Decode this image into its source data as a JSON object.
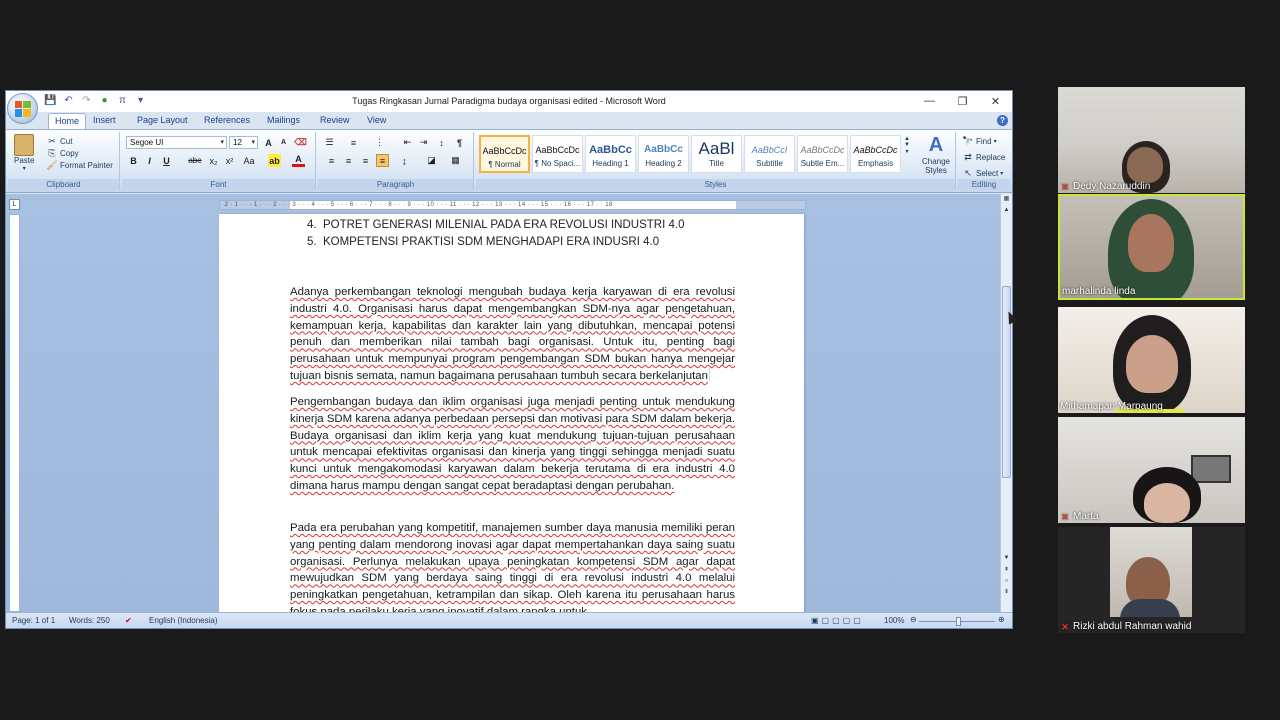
{
  "window": {
    "title": "Tugas Ringkasan Jurnal Paradigma budaya organisasi edited - Microsoft Word",
    "minimize": "—",
    "restore": "❐",
    "close": "✕"
  },
  "ribbon_tabs": [
    "Home",
    "Insert",
    "Page Layout",
    "References",
    "Mailings",
    "Review",
    "View"
  ],
  "clipboard": {
    "paste": "Paste",
    "cut": "Cut",
    "copy": "Copy",
    "format_painter": "Format Painter",
    "label": "Clipboard"
  },
  "font": {
    "family": "Segoe UI",
    "size": "12",
    "label": "Font",
    "bold": "B",
    "italic": "I",
    "underline": "U",
    "strike": "abe",
    "subscript": "x₂",
    "superscript": "x²",
    "change_case": "Aa",
    "grow": "A",
    "shrink": "A"
  },
  "paragraph": {
    "label": "Paragraph"
  },
  "styles": {
    "label": "Styles",
    "items": [
      {
        "preview": "AaBbCcDc",
        "name": "¶ Normal"
      },
      {
        "preview": "AaBbCcDc",
        "name": "¶ No Spaci..."
      },
      {
        "preview": "AaBbCc",
        "name": "Heading 1"
      },
      {
        "preview": "AaBbCc",
        "name": "Heading 2"
      },
      {
        "preview": "AaBl",
        "name": "Title"
      },
      {
        "preview": "AaBbCcI",
        "name": "Subtitle"
      },
      {
        "preview": "AaBbCcDc",
        "name": "Subtle Em..."
      },
      {
        "preview": "AaBbCcDc",
        "name": "Emphasis"
      }
    ],
    "change_styles": "Change Styles"
  },
  "editing": {
    "label": "Editing",
    "find": "Find",
    "replace": "Replace",
    "select": "Select"
  },
  "document": {
    "list": [
      "4.  POTRET GENERASI MILENIAL PADA ERA REVOLUSI INDUSTRI 4.0",
      "5.  KOMPETENSI PRAKTISI SDM MENGHADAPI ERA INDUSRI 4.0"
    ],
    "para1": "Adanya perkembangan teknologi mengubah budaya kerja karyawan di era revolusi industri 4.0. Organisasi harus dapat mengembangkan SDM-nya agar pengetahuan, kemampuan kerja, kapabilitas dan karakter lain yang dibutuhkan, mencapai potensi penuh dan memberikan nilai tambah bagi organisasi. Untuk itu, penting bagi perusahaan untuk mempunyai program pengembangan SDM bukan hanya mengejar tujuan bisnis semata, namun bagaimana perusahaan tumbuh secara berkelanjutan",
    "para2": "Pengembangan budaya dan iklim organisasi juga menjadi penting untuk mendukung kinerja SDM karena adanya perbedaan persepsi dan motivasi para SDM dalam bekerja. Budaya organisasi dan iklim kerja yang kuat mendukung tujuan-tujuan perusahaan untuk mencapai efektivitas organisasi dan kinerja yang tinggi sehingga menjadi suatu kunci untuk mengakomodasi karyawan dalam bekerja terutama di era industri 4.0 dimana  harus mampu dengan sangat cepat beradaptasi dengan perubahan.",
    "para3": "Pada era perubahan yang kompetitif, manajemen sumber daya manusia memiliki peran yang penting dalam mendorong inovasi agar dapat mempertahankan daya saing suatu organisasi. Perlunya melakukan upaya peningkatan kompetensi SDM agar dapat mewujudkan SDM yang berdaya saing tinggi di era revolusi industri 4.0 melalui peningkatkan pengetahuan, ketrampilan dan sikap. Oleh karena itu perusahaan harus fokus pada perilaku kerja yang inovatif dalam rangka untuk"
  },
  "status": {
    "page": "Page: 1 of 1",
    "words": "Words: 250",
    "language": "English (Indonesia)",
    "zoom": "100%"
  },
  "participants": [
    {
      "name": "Dedy Nazaruddin",
      "muted": true
    },
    {
      "name": "marhalinda linda",
      "muted": false,
      "speaking": true
    },
    {
      "name": "Mithamapan Marpaung",
      "muted": false
    },
    {
      "name": "Marta",
      "muted": true
    },
    {
      "name": "Rizki abdul Rahman wahid",
      "muted": true
    }
  ],
  "colors": {
    "ribbon_blue": "#dbe5f1",
    "doc_bg": "#a8c0e2",
    "active_speaker": "#c7e832",
    "spell_underline": "#dd3333"
  }
}
